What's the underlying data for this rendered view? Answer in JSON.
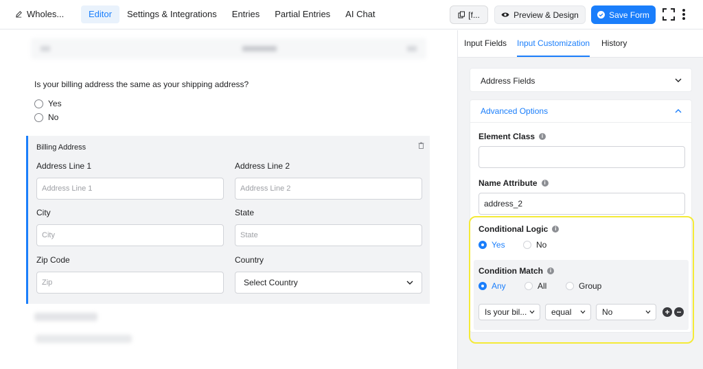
{
  "topbar": {
    "form_name": "Wholes...",
    "nav": [
      "Editor",
      "Settings & Integrations",
      "Entries",
      "Partial Entries",
      "AI Chat"
    ],
    "shortcode_label": "[f...",
    "preview_label": "Preview & Design",
    "save_label": "Save Form",
    "accent_color": "#1a7efb"
  },
  "canvas": {
    "question": "Is your billing address the same as your shipping address?",
    "options": [
      "Yes",
      "No"
    ],
    "billing": {
      "title": "Billing Address",
      "address1_label": "Address Line 1",
      "address1_placeholder": "Address Line 1",
      "address2_label": "Address Line 2",
      "address2_placeholder": "Address Line 2",
      "city_label": "City",
      "city_placeholder": "City",
      "state_label": "State",
      "state_placeholder": "State",
      "zip_label": "Zip Code",
      "zip_placeholder": "Zip",
      "country_label": "Country",
      "country_value": "Select Country"
    }
  },
  "panel": {
    "tabs": [
      "Input Fields",
      "Input Customization",
      "History"
    ],
    "active_tab": "Input Customization",
    "address_fields_title": "Address Fields",
    "advanced_title": "Advanced Options",
    "element_class_label": "Element Class",
    "element_class_value": "",
    "name_attribute_label": "Name Attribute",
    "name_attribute_value": "address_2",
    "conditional_logic_label": "Conditional Logic",
    "conditional_logic_options": [
      "Yes",
      "No"
    ],
    "conditional_logic_selected": "Yes",
    "condition_match_label": "Condition Match",
    "condition_match_options": [
      "Any",
      "All",
      "Group"
    ],
    "condition_match_selected": "Any",
    "rule": {
      "field": "Is your bil...",
      "operator": "equal",
      "value": "No"
    },
    "highlight_color": "#f4ea37"
  }
}
